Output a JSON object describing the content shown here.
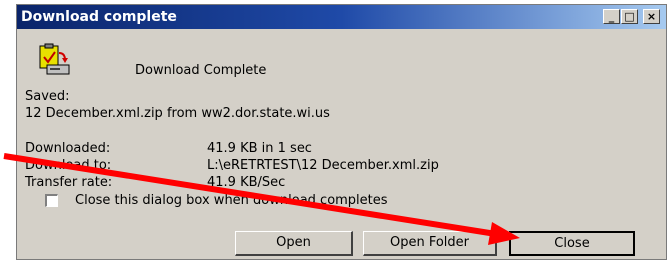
{
  "window": {
    "title": "Download complete",
    "minimize": "_",
    "maximize": "□",
    "close": "×"
  },
  "header": {
    "message": "Download Complete"
  },
  "saved": {
    "label": "Saved:",
    "value": "12 December.xml.zip from ww2.dor.state.wi.us"
  },
  "details": {
    "downloaded_label": "Downloaded:",
    "downloaded_value": "41.9 KB in 1 sec",
    "download_to_label": "Download to:",
    "download_to_value": "L:\\eRETRTEST\\12 December.xml.zip",
    "rate_label": "Transfer rate:",
    "rate_value": "41.9 KB/Sec"
  },
  "checkbox": {
    "label": "Close this dialog box when download completes",
    "checked": false
  },
  "buttons": {
    "open": "Open",
    "open_folder": "Open Folder",
    "close": "Close"
  },
  "annotation": {
    "color": "#ff0000"
  }
}
